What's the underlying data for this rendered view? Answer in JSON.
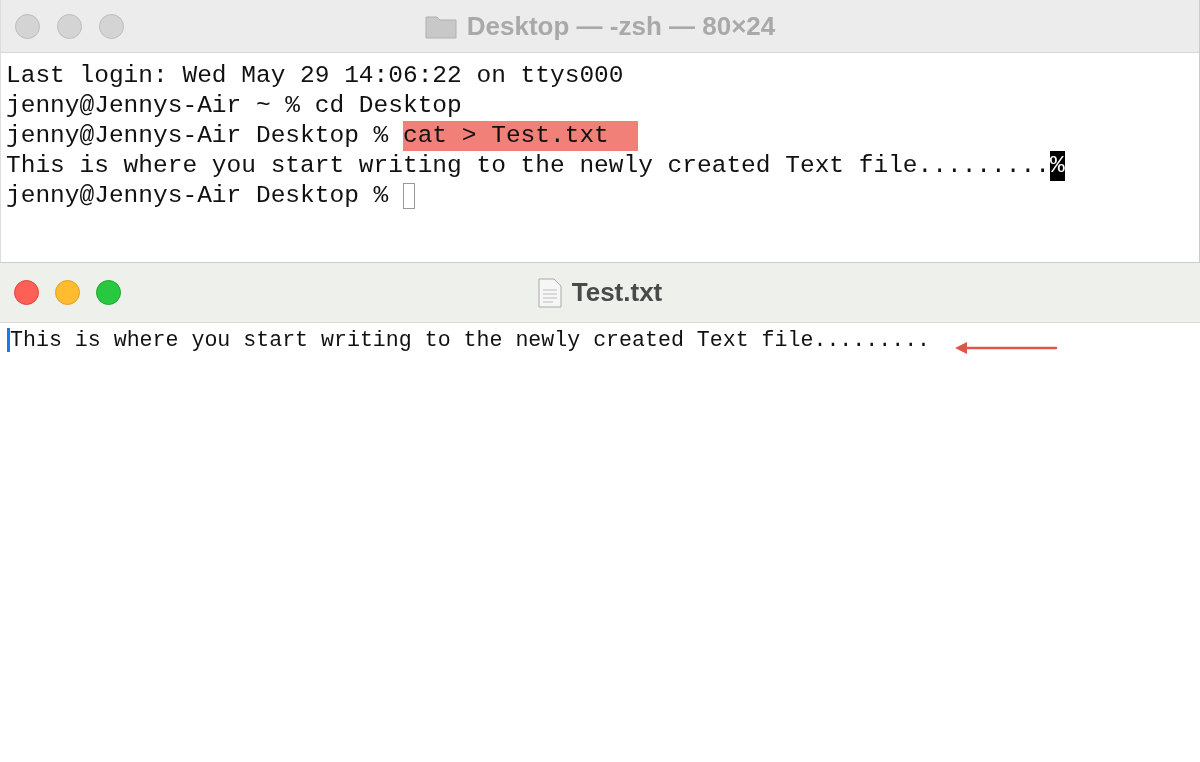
{
  "terminal": {
    "title": "Desktop — -zsh — 80×24",
    "active": false,
    "lines": [
      {
        "segments": [
          {
            "text": "Last login: Wed May 29 14:06:22 on ttys000",
            "kind": "plain"
          }
        ],
        "cursor": false
      },
      {
        "segments": [
          {
            "text": "jenny@Jennys-Air ~ % cd Desktop",
            "kind": "plain"
          }
        ],
        "cursor": false
      },
      {
        "segments": [
          {
            "text": "jenny@Jennys-Air Desktop % ",
            "kind": "plain"
          },
          {
            "text": "cat > Test.txt  ",
            "kind": "highlight"
          }
        ],
        "cursor": false
      },
      {
        "segments": [
          {
            "text": "This is where you start writing to the newly created Text file.........",
            "kind": "plain"
          },
          {
            "text": "%",
            "kind": "inverse"
          }
        ],
        "cursor": false
      },
      {
        "segments": [
          {
            "text": "jenny@Jennys-Air Desktop % ",
            "kind": "plain"
          }
        ],
        "cursor": true
      }
    ]
  },
  "editor": {
    "title": "Test.txt",
    "active": true,
    "text": "This is where you start writing to the newly created Text file........."
  }
}
